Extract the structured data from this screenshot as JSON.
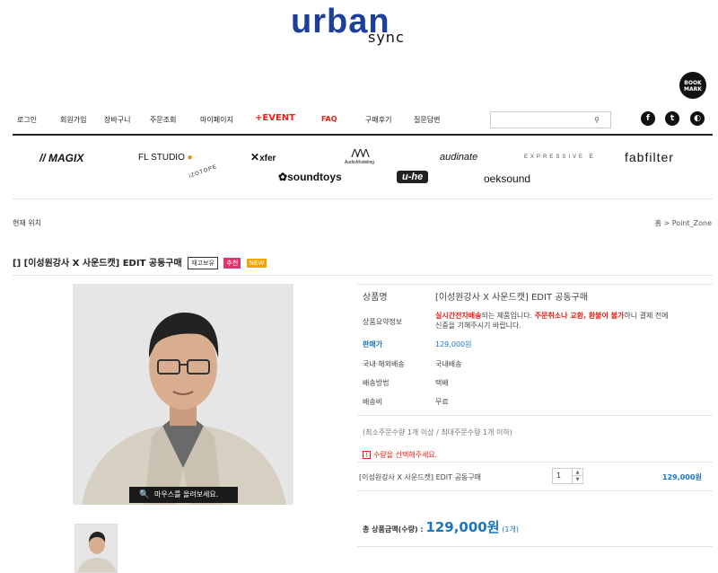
{
  "logo": {
    "main": "urban",
    "sub": "sync"
  },
  "bookmark": {
    "line1": "BOOK",
    "line2": "MARK"
  },
  "nav": {
    "items": [
      "로그인",
      "회원가입",
      "장바구니",
      "주문조회",
      "마이페이지",
      "+EVENT",
      "FAQ",
      "구매후기",
      "질문답변"
    ],
    "search_placeholder": "",
    "search_icon": "magnifier-icon",
    "social": [
      {
        "name": "facebook-icon",
        "glyph": "f"
      },
      {
        "name": "twitter-icon",
        "glyph": "t"
      },
      {
        "name": "kakao-icon",
        "glyph": "◐"
      }
    ]
  },
  "brands": [
    "MAGIX",
    "FL STUDIO",
    "xfer",
    "AudioModeling",
    "audinate",
    "EXPRESSIVE E",
    "fabfilter",
    "iZOTOPE",
    "soundtoys",
    "u-he",
    "oeksound"
  ],
  "location": {
    "label": "현재 위치",
    "home": "홈",
    "sep": ">",
    "current": "Point_Zone"
  },
  "product": {
    "title": "[] [이성원강사 X 사운드캣] EDIT 공동구매",
    "badges": [
      "재고보유",
      "추천",
      "NEW"
    ],
    "zoom_text": "마우스를 올려보세요."
  },
  "info": {
    "name_label": "상품명",
    "name_value": "[이성원강사 X 사운드캣] EDIT 공동구매",
    "summary_label": "상품요약정보",
    "summary_red1": "실시간전자배송",
    "summary_mid1": "되는 제품입니다. ",
    "summary_red2": "주문취소나 교환, 환불이 불가",
    "summary_mid2": "하니 결제 전에",
    "summary_line2": "신중을 기해주시기 바랍니다.",
    "price_label": "판매가",
    "price_value": "129,000원",
    "ship_type_label": "국내·해외배송",
    "ship_type_value": "국내배송",
    "ship_method_label": "배송방법",
    "ship_method_value": "택배",
    "ship_fee_label": "배송비",
    "ship_fee_value": "무료",
    "min_max": "(최소주문수량 1개 이상 / 최대주문수량 1개 이하)",
    "warning_icon": "!",
    "warning_text": "수량을 선택해주세요.",
    "option_name": "[이성원강사 X 사운드캣] EDIT 공동구매",
    "qty_value": "1",
    "option_price": "129,000원",
    "total_label": "총 상품금액(수량) : ",
    "total_value": "129,000원",
    "total_count": "(1개)"
  },
  "colors": {
    "brand_blue": "#1b3f9a",
    "accent_red": "#e2231a",
    "price_blue": "#1a76c2"
  }
}
